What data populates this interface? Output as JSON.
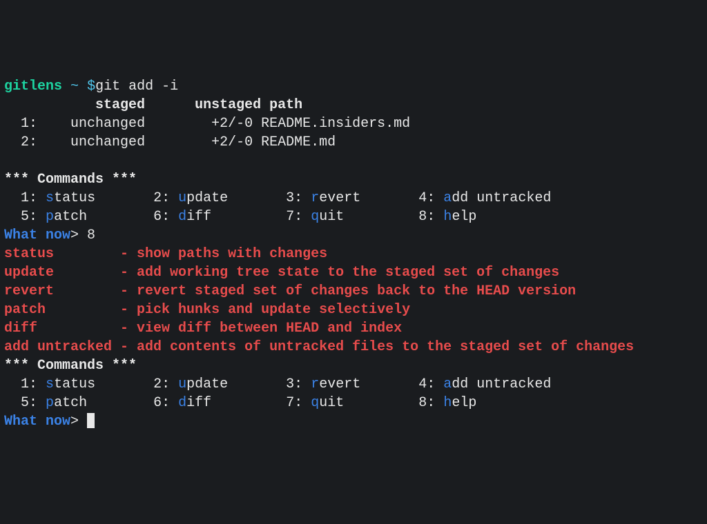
{
  "prompt": {
    "dir": "gitlens",
    "sep": "~",
    "symbol": "$",
    "command": "git add -i"
  },
  "status_header": {
    "col1": "staged",
    "col2": "unstaged",
    "col3": "path"
  },
  "status_rows": [
    {
      "idx": "1:",
      "staged": "unchanged",
      "unstaged": "+2/-0",
      "path": "README.insiders.md"
    },
    {
      "idx": "2:",
      "staged": "unchanged",
      "unstaged": "+2/-0",
      "path": "README.md"
    }
  ],
  "commands_header": "*** Commands ***",
  "commands": [
    {
      "n": "1:",
      "k": "s",
      "rest": "tatus"
    },
    {
      "n": "2:",
      "k": "u",
      "rest": "pdate"
    },
    {
      "n": "3:",
      "k": "r",
      "rest": "evert"
    },
    {
      "n": "4:",
      "k": "a",
      "rest": "dd untracked"
    },
    {
      "n": "5:",
      "k": "p",
      "rest": "atch"
    },
    {
      "n": "6:",
      "k": "d",
      "rest": "iff"
    },
    {
      "n": "7:",
      "k": "q",
      "rest": "uit"
    },
    {
      "n": "8:",
      "k": "h",
      "rest": "elp"
    }
  ],
  "prompt_what": "What now",
  "prompt_gt": "> ",
  "input1": "8",
  "help": [
    {
      "cmd": "status       ",
      "sep": " - ",
      "desc": "show paths with changes"
    },
    {
      "cmd": "update       ",
      "sep": " - ",
      "desc": "add working tree state to the staged set of changes"
    },
    {
      "cmd": "revert       ",
      "sep": " - ",
      "desc": "revert staged set of changes back to the HEAD version"
    },
    {
      "cmd": "patch        ",
      "sep": " - ",
      "desc": "pick hunks and update selectively"
    },
    {
      "cmd": "diff         ",
      "sep": " - ",
      "desc": "view diff between HEAD and index"
    },
    {
      "cmd": "add untracked",
      "sep": " - ",
      "desc": "add contents of untracked files to the staged set of changes"
    }
  ]
}
